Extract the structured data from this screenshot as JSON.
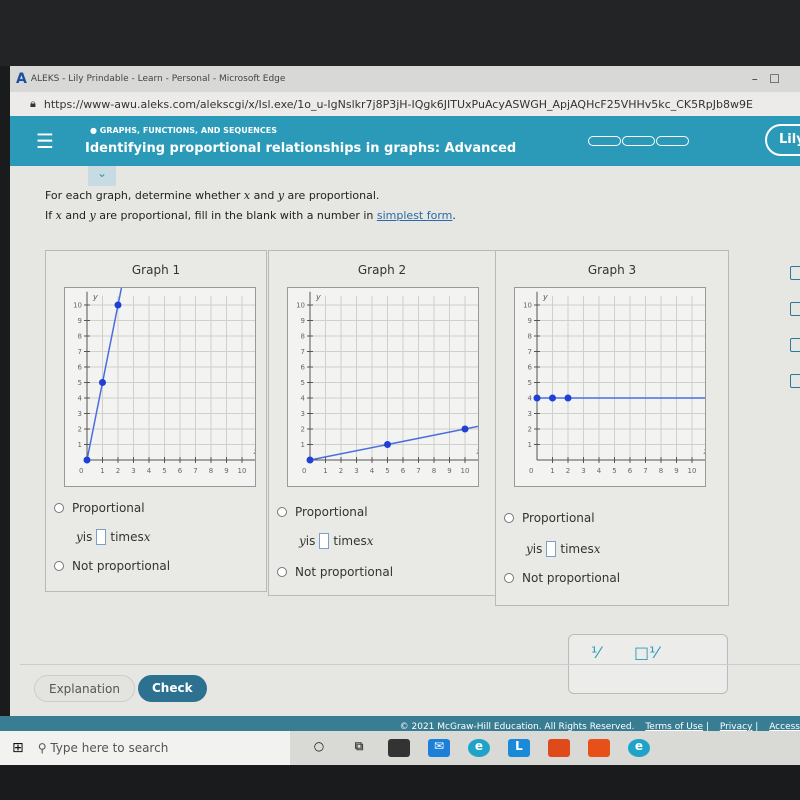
{
  "browser": {
    "title": "ALEKS - Lily Prindable - Learn - Personal - Microsoft Edge",
    "url": "https://www-awu.aleks.com/alekscgi/x/Isl.exe/1o_u-IgNslkr7j8P3jH-IQgk6JITUxPuAcyASWGH_ApjAQHcF25VHHv5kc_CK5RpJb8w9E"
  },
  "header": {
    "category": "GRAPHS, FUNCTIONS, AND SEQUENCES",
    "title": "Identifying proportional relationships in graphs: Advanced",
    "user": "Lily",
    "progress_segments": 3
  },
  "instructions": {
    "line1_a": "For each graph, determine whether ",
    "x": "x",
    "and": " and ",
    "y": "y",
    "line1_b": " are proportional.",
    "line2_a": "If ",
    "line2_b": " are proportional, fill in the blank with a number in ",
    "link": "simplest form",
    "period": "."
  },
  "graphs": [
    {
      "title": "Graph 1",
      "points": [
        [
          0,
          0
        ],
        [
          1,
          5
        ],
        [
          2,
          10
        ]
      ]
    },
    {
      "title": "Graph 2",
      "points": [
        [
          0,
          0
        ],
        [
          5,
          1
        ],
        [
          10,
          2
        ]
      ]
    },
    {
      "title": "Graph 3",
      "points": [
        [
          0,
          4
        ],
        [
          1,
          4
        ],
        [
          2,
          4
        ]
      ]
    }
  ],
  "axes": {
    "xlabel": "x",
    "ylabel": "y",
    "xlim": [
      0,
      10
    ],
    "ylim": [
      0,
      10
    ],
    "origin_label": "0",
    "line_color": "#4a6ee0",
    "point_color": "#1f3fd6"
  },
  "options": {
    "proportional": "Proportional",
    "y": "y",
    "is": " is",
    "times": "times ",
    "x": "x",
    "not_proportional": "Not proportional"
  },
  "buttons": {
    "explanation": "Explanation",
    "check": "Check"
  },
  "footer": {
    "copyright": "© 2021 McGraw-Hill Education. All Rights Reserved.",
    "terms": "Terms of Use",
    "privacy": "Privacy",
    "accessibility": "Access"
  },
  "taskbar": {
    "search_placeholder": "Type here to search"
  }
}
